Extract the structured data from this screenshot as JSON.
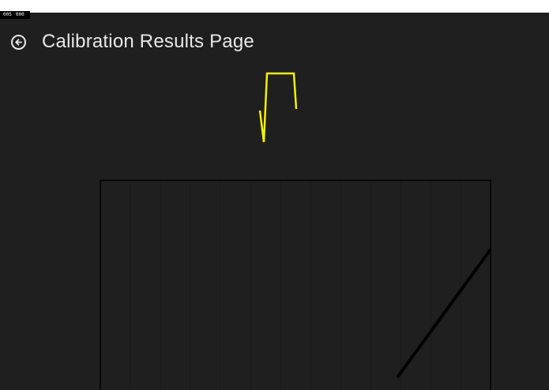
{
  "debug": {
    "left": "005",
    "right": "000"
  },
  "header": {
    "title": "Calibration Results Page",
    "back_icon": "arrow-left-circle-icon"
  },
  "colors": {
    "background": "#1f1f1f",
    "title": "#e8e8e8",
    "glyph": "#f2f200",
    "plot_border": "#000000",
    "calibration_line": "#000000"
  },
  "chart_data": {
    "type": "line",
    "grid": true,
    "vertical_grid_divisions": 13
  }
}
